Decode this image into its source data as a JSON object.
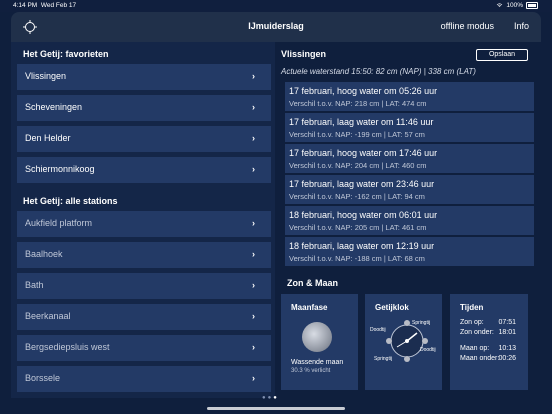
{
  "status": {
    "time": "4:14 PM",
    "date": "Wed Feb 17",
    "battery": "100%"
  },
  "nav": {
    "title": "IJmuiderslag",
    "offline": "offline modus",
    "info": "Info",
    "locate_icon": "crosshair-icon"
  },
  "favorites": {
    "heading": "Het Getij: favorieten",
    "items": [
      "Vlissingen",
      "Scheveningen",
      "Den Helder",
      "Schiermonnikoog"
    ]
  },
  "stations": {
    "heading": "Het Getij: alle stations",
    "items": [
      "Aukfield platform",
      "Baalhoek",
      "Bath",
      "Beerkanaal",
      "Bergsediepsluis west",
      "Borssele"
    ]
  },
  "detail": {
    "station": "Vlissingen",
    "save": "Opslaan",
    "current": "Actuele waterstand 15:50: 82 cm (NAP) | 338 cm (LAT)",
    "tides": [
      {
        "title": "17 februari, hoog water om 05:26 uur",
        "sub": "Verschil t.o.v. NAP: 218 cm | LAT: 474 cm"
      },
      {
        "title": "17 februari, laag water om 11:46 uur",
        "sub": "Verschil t.o.v. NAP: -199 cm | LAT: 57 cm"
      },
      {
        "title": "17 februari, hoog water om 17:46 uur",
        "sub": "Verschil t.o.v. NAP: 204 cm | LAT: 460 cm"
      },
      {
        "title": "17 februari, laag water om 23:46 uur",
        "sub": "Verschil t.o.v. NAP: -162 cm | LAT: 94 cm"
      },
      {
        "title": "18 februari, hoog water om 06:01 uur",
        "sub": "Verschil t.o.v. NAP: 205 cm | LAT: 461 cm"
      },
      {
        "title": "18 februari, laag water om 12:19 uur",
        "sub": "Verschil t.o.v. NAP: -188 cm | LAT: 68 cm"
      }
    ]
  },
  "zonmaan": {
    "heading": "Zon & Maan",
    "maanfase": {
      "title": "Maanfase",
      "label": "Wassende maan",
      "pct": "30.3 % verlicht"
    },
    "getijklok": {
      "title": "Getijklok",
      "labels": [
        "Doodtij",
        "Springtij",
        "Doodtij",
        "Springtij"
      ]
    },
    "tijden": {
      "title": "Tijden",
      "rows": [
        {
          "label": "Zon op:",
          "value": "07:51"
        },
        {
          "label": "Zon onder:",
          "value": "18:01"
        },
        {
          "label": "Maan op:",
          "value": "10:13"
        },
        {
          "label": "Maan onder:",
          "value": "00:26"
        }
      ]
    }
  },
  "colors": {
    "background": "#0f1f3d",
    "row": "#233a66",
    "panel": "#142648"
  }
}
